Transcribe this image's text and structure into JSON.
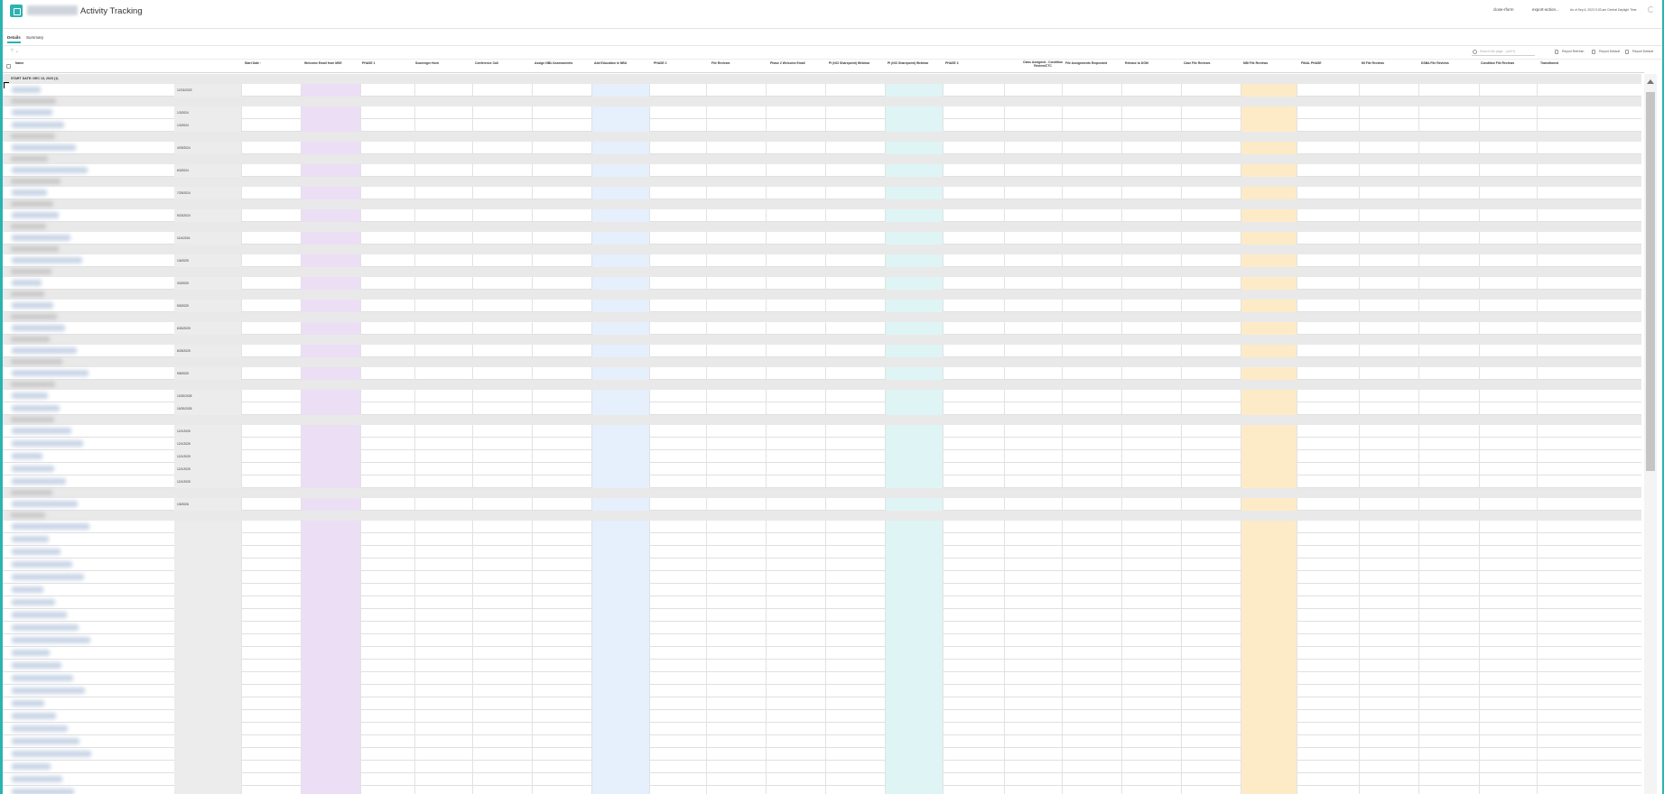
{
  "app": {
    "title": "Activity Tracking"
  },
  "header": {
    "links": [
      "close-rform",
      "export-action..."
    ],
    "timestamp": "As of Sep 6, 2023 9:33 am Central Daylight Time"
  },
  "tabs": [
    {
      "label": "Details",
      "active": true
    },
    {
      "label": "Summary",
      "active": false
    }
  ],
  "toolbar": {
    "filter_label": "⊤ ⌄",
    "search_placeholder": "Search this page ...(ctrl+f)",
    "buttons": [
      "Report Refresh",
      "Report Default",
      "Report Default"
    ]
  },
  "columns": [
    "Name",
    "Start Date ↑",
    "Welcome Email from MSE",
    "PHASE 1",
    "Scavenger Hunt",
    "Conference Call",
    "Assign NBU Assessments",
    "Add Education in NBU",
    "PHASE 2",
    "File Reviews",
    "Phase 2 Welcome Email",
    "PI (NCI Sharepoint) Webinar",
    "PI (NCI Sharepoint) Webinar",
    "PHASE 3",
    "Class Assigned - Condition Review/CTC",
    "File Assignments Requested",
    "Release to DGM",
    "Case File Reviews",
    "NBI File Reviews",
    "FINAL PHASE",
    "MI File Reviews",
    "DSBA File Reviews",
    "Condition File Reviews",
    "Transitioned"
  ],
  "grid": {
    "first_group_label": "START DATE: DEC 13, 2023 (1)",
    "dates": [
      "12/13/2023",
      "1/3/2024",
      "1/3/2024",
      "4/29/2024",
      "6/3/2024",
      "7/29/2024",
      "9/23/2024",
      "11/4/2024",
      "1/6/2025",
      "3/3/2025",
      "5/5/2025",
      "6/30/2025",
      "8/25/2025",
      "9/8/2025",
      "10/20/2025",
      "10/20/2025",
      "12/1/2025",
      "12/1/2025",
      "12/1/2025",
      "12/1/2025",
      "12/1/2025",
      "1/5/2026"
    ]
  },
  "colors": {
    "accent": "#2bb3b1",
    "phase1": "#ecdff5",
    "phase2": "#e6effc",
    "phase3": "#dff4f4",
    "final_phase": "#fdebc8",
    "start_date": "#ececec"
  }
}
